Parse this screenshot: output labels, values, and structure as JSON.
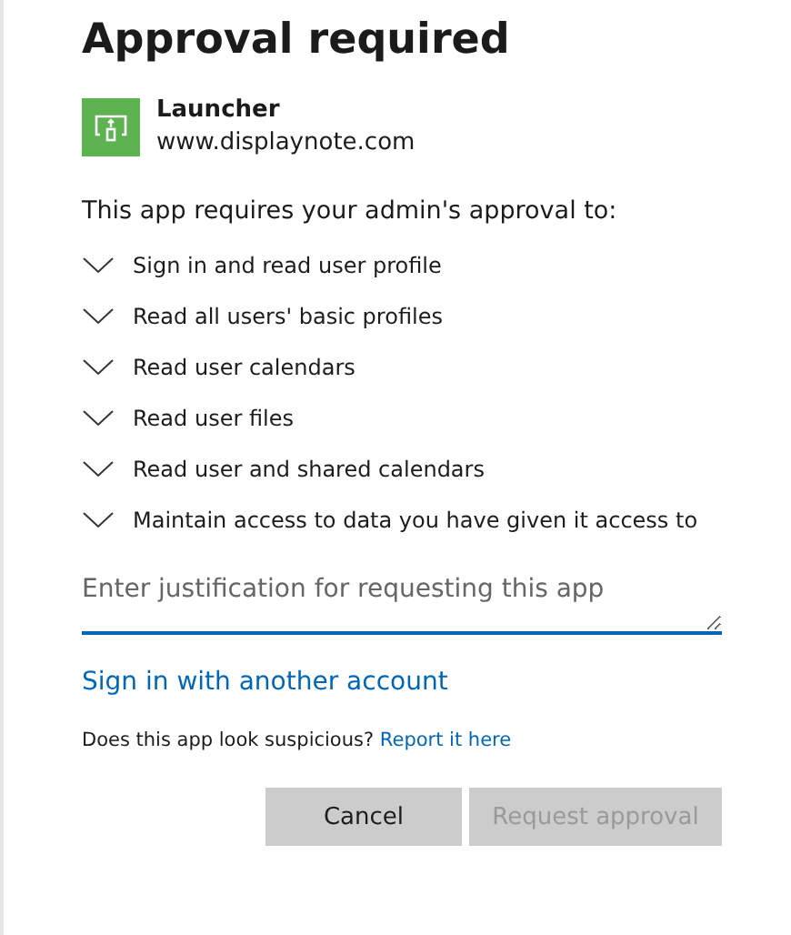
{
  "title": "Approval required",
  "app": {
    "name": "Launcher",
    "publisher": "www.displaynote.com"
  },
  "intro": "This app requires your admin's approval to:",
  "permissions": [
    {
      "label": "Sign in and read user profile",
      "expanded": false
    },
    {
      "label": "Read all users' basic profiles",
      "expanded": false
    },
    {
      "label": "Read user calendars",
      "expanded": false
    },
    {
      "label": "Read user files",
      "expanded": false
    },
    {
      "label": "Read user and shared calendars",
      "expanded": false
    },
    {
      "label": "Maintain access to data you have given it access to",
      "expanded": false
    }
  ],
  "justification": {
    "placeholder": "Enter justification for requesting this app"
  },
  "switch_account_link": "Sign in with another account",
  "report": {
    "question": "Does this app look suspicious?",
    "link": "Report it here"
  },
  "buttons": [
    {
      "label": "Cancel",
      "disabled": false
    },
    {
      "label": "Request approval",
      "disabled": true
    }
  ]
}
